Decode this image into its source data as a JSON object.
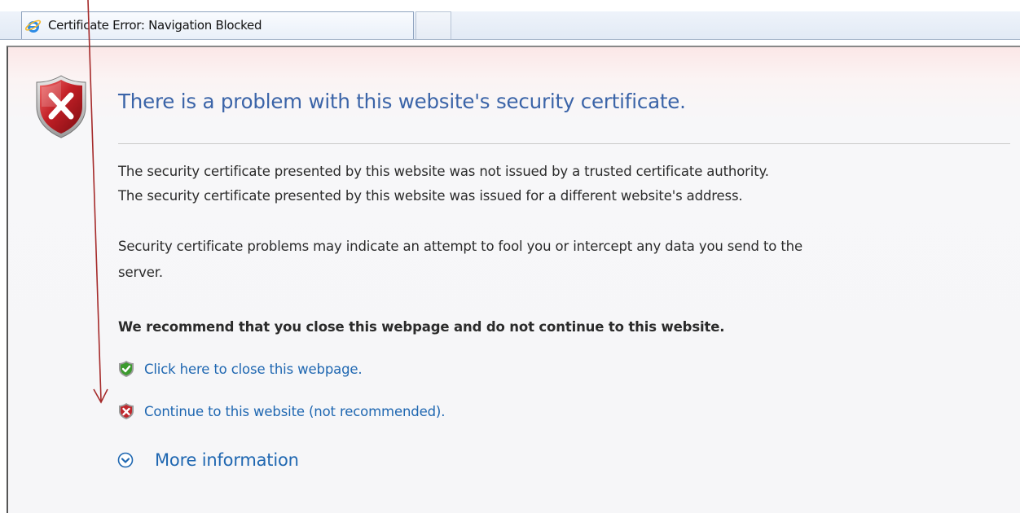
{
  "tab": {
    "title": "Certificate Error: Navigation Blocked",
    "icon": "ie-logo-icon"
  },
  "page": {
    "heading": "There is a problem with this website's security certificate.",
    "paragraphs": [
      "The security certificate presented by this website was not issued by a trusted certificate authority.",
      "The security certificate presented by this website was issued for a different website's address.",
      "Security certificate problems may indicate an attempt to fool you or intercept any data you send to the",
      "server."
    ],
    "recommendation": "We recommend that you close this webpage and do not continue to this website.",
    "links": {
      "close": "Click here to close this webpage.",
      "continue": "Continue to this website (not recommended)."
    },
    "more_info": "More information"
  },
  "colors": {
    "heading": "#3b64a8",
    "link": "#1f67b1",
    "annotation_arrow": "#a52a2a",
    "shield_red": "#c0272d",
    "shield_green": "#3c9a2e"
  },
  "icons": {
    "error_shield": "shield-error-icon",
    "close_link": "green-shield-check-icon",
    "continue_link": "red-shield-x-icon",
    "more_info": "chevron-down-circle-icon"
  }
}
